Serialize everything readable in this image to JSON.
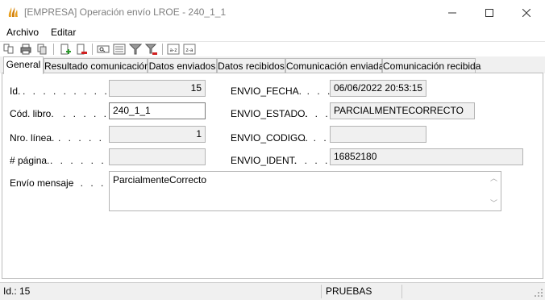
{
  "window": {
    "title": "[EMPRESA] Operación envío LROE - 240_1_1",
    "icon": "app-flame-icon"
  },
  "menu": {
    "items": [
      "Archivo",
      "Editar"
    ]
  },
  "toolbar": {
    "icons": [
      "new-doc-icon",
      "print-icon",
      "copy-icon",
      "add-doc-icon",
      "delete-doc-icon",
      "search-icon",
      "list-icon",
      "filter-icon",
      "clear-filter-icon",
      "sort-asc-icon",
      "sort-desc-icon"
    ]
  },
  "tabs": [
    {
      "label": "General",
      "active": true
    },
    {
      "label": "Resultado comunicación",
      "active": false
    },
    {
      "label": "Datos enviados",
      "active": false
    },
    {
      "label": "Datos recibidos",
      "active": false
    },
    {
      "label": "Comunicación enviada",
      "active": false
    },
    {
      "label": "Comunicación recibida",
      "active": false
    }
  ],
  "form": {
    "id_label": "Id.",
    "id_value": "15",
    "libro_label": "Cód. libro.",
    "libro_value": "240_1_1",
    "linea_label": "Nro. línea.",
    "linea_value": "1",
    "pagina_label": "# página.",
    "pagina_value": "",
    "mensaje_label": "Envío mensaje",
    "mensaje_value": "ParcialmenteCorrecto",
    "fecha_label": "ENVIO_FECHA.",
    "fecha_value": "06/06/2022 20:53:15",
    "estado_label": "ENVIO_ESTADO.",
    "estado_value": "PARCIALMENTECORRECTO",
    "codigo_label": "ENVIO_CODIGO.",
    "codigo_value": "",
    "ident_label": "ENVIO_IDENT.",
    "ident_value": "16852180"
  },
  "status": {
    "id": "Id.: 15",
    "env": "PRUEBAS"
  },
  "colors": {
    "panel_bg": "#ffffff",
    "readonly_bg": "#f0f0f0",
    "border": "#b4b4b4"
  }
}
